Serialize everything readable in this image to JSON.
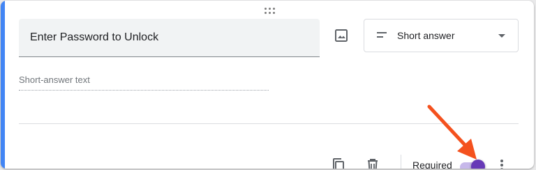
{
  "question": {
    "title": "Enter Password to Unlock",
    "answer_placeholder": "Short-answer text"
  },
  "type_selector": {
    "selected": "Short answer",
    "icon": "short-text-icon"
  },
  "footer": {
    "required_label": "Required",
    "required_on": true
  },
  "icons": {
    "image": "image-icon",
    "copy": "copy-icon",
    "delete": "trash-icon",
    "more": "more-vert-icon",
    "drag": "drag-handle-icon"
  },
  "colors": {
    "accent": "#4285f4",
    "toggle_thumb": "#673ab7",
    "toggle_track": "#c7b8ea",
    "arrow": "#f4511e"
  }
}
